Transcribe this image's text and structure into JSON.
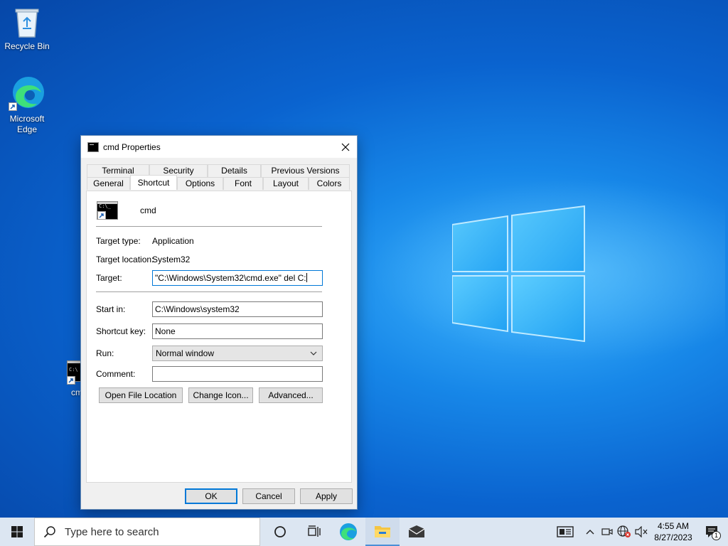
{
  "desktop": {
    "icons": [
      {
        "label": "Recycle Bin"
      },
      {
        "label": "Microsoft Edge"
      },
      {
        "label": "cmd"
      }
    ]
  },
  "dialog": {
    "title": "cmd Properties",
    "tabs_back": [
      "Terminal",
      "Security",
      "Details",
      "Previous Versions"
    ],
    "tabs_front": [
      "General",
      "Shortcut",
      "Options",
      "Font",
      "Layout",
      "Colors"
    ],
    "active_tab": "Shortcut",
    "shortcut_name": "cmd",
    "target_type_label": "Target type:",
    "target_type_value": "Application",
    "target_location_label": "Target location:",
    "target_location_value": "System32",
    "target_label": "Target:",
    "target_value": "\"C:\\Windows\\System32\\cmd.exe\" del C:",
    "start_in_label": "Start in:",
    "start_in_value": "C:\\Windows\\system32",
    "shortcut_key_label": "Shortcut key:",
    "shortcut_key_value": "None",
    "run_label": "Run:",
    "run_value": "Normal window",
    "comment_label": "Comment:",
    "comment_value": "",
    "open_file_location": "Open File Location",
    "change_icon": "Change Icon...",
    "advanced": "Advanced...",
    "ok": "OK",
    "cancel": "Cancel",
    "apply": "Apply"
  },
  "taskbar": {
    "search_placeholder": "Type here to search",
    "time": "4:55 AM",
    "date": "8/27/2023",
    "notification_count": "1"
  },
  "colors": {
    "accent": "#0078d7"
  }
}
